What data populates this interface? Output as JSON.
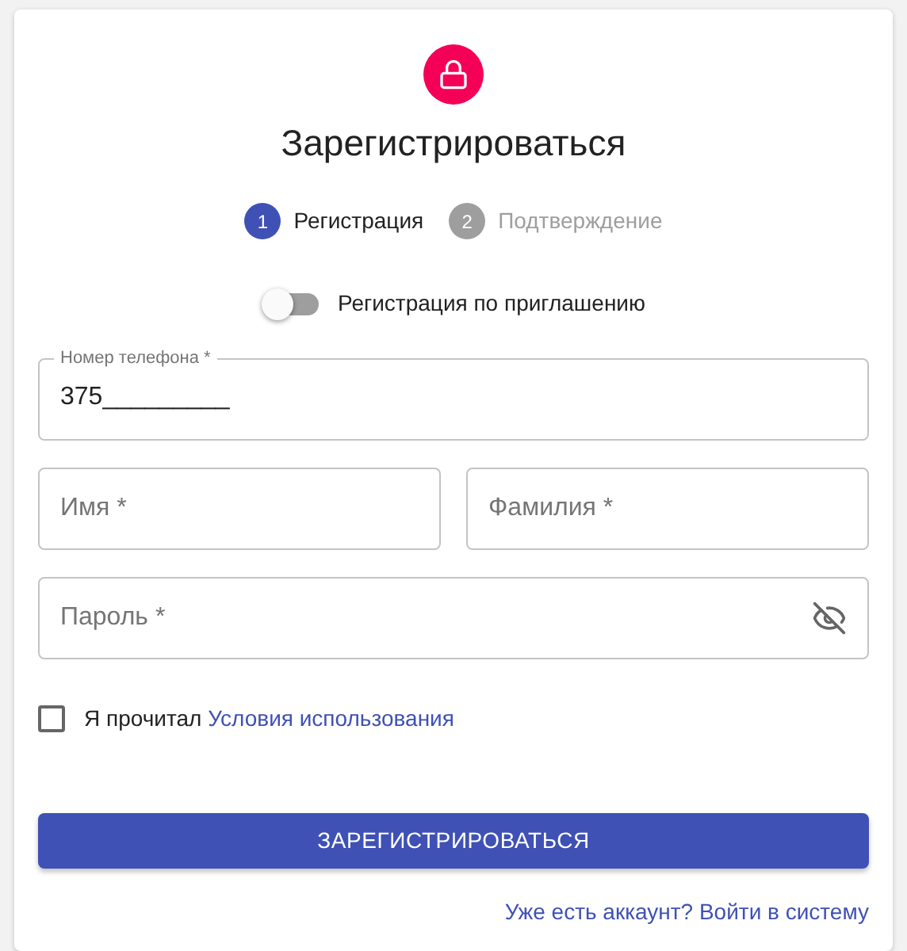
{
  "title": "Зарегистрироваться",
  "steps": [
    {
      "number": "1",
      "label": "Регистрация",
      "selected": true
    },
    {
      "number": "2",
      "label": "Подтверждение",
      "selected": false
    }
  ],
  "invite_switch": {
    "label": "Регистрация по приглашению",
    "on": false
  },
  "phone": {
    "label": "Номер телефона *",
    "value": "375_________"
  },
  "first_name": {
    "label": "Имя *"
  },
  "last_name": {
    "label": "Фамилия *"
  },
  "password": {
    "label": "Пароль *"
  },
  "terms": {
    "text": "Я прочитал",
    "link": "Условия использования",
    "checked": false
  },
  "submit": "ЗАРЕГИСТРИРОВАТЬСЯ",
  "login_link": "Уже есть аккаунт? Войти в систему"
}
